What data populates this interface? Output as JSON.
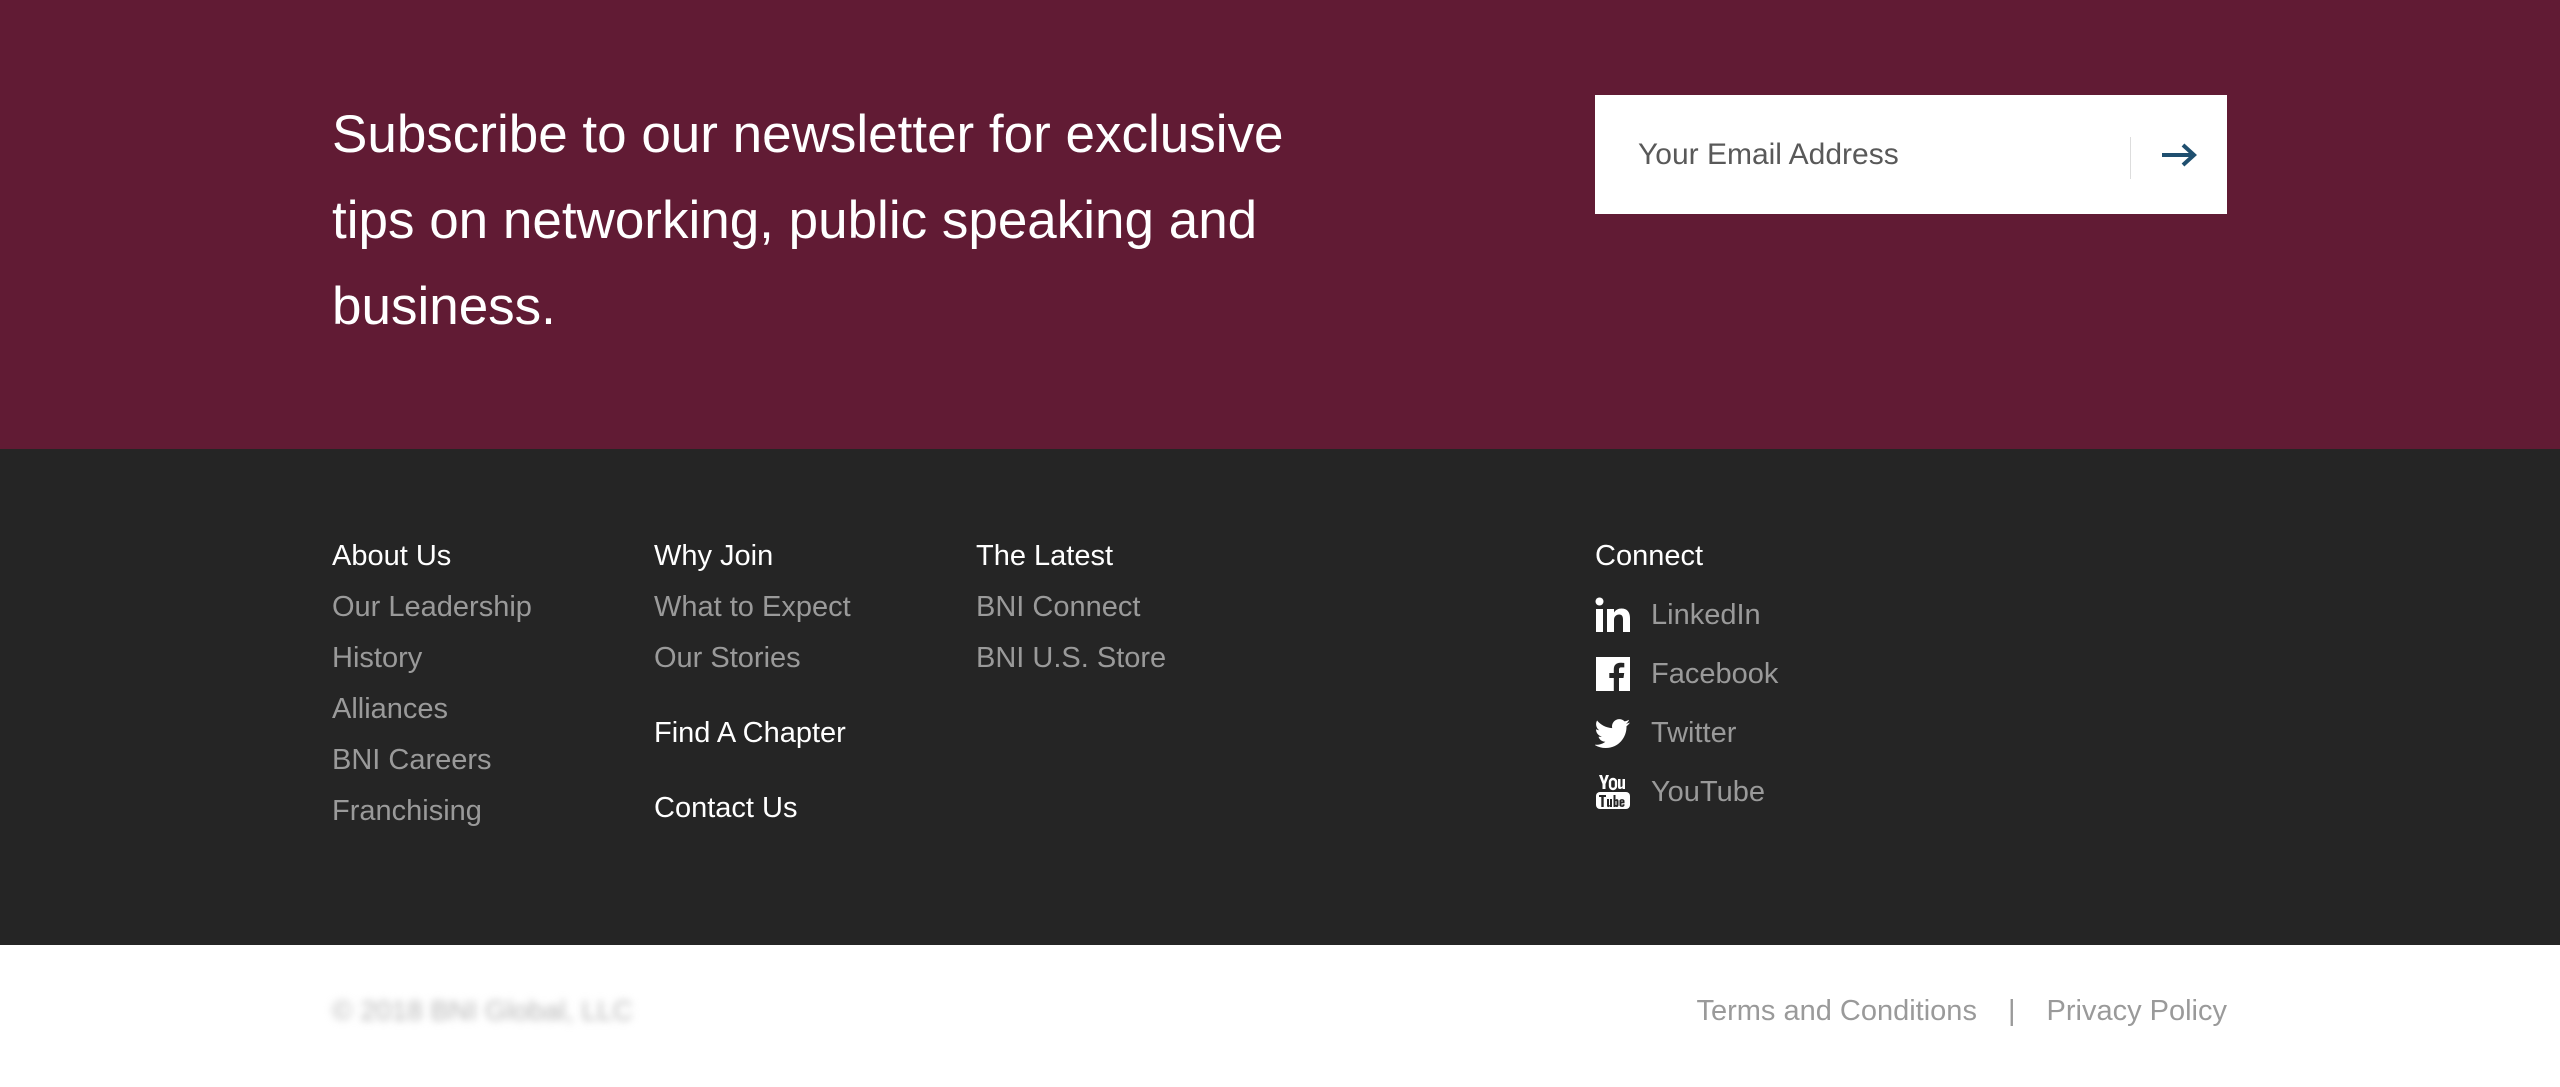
{
  "newsletter": {
    "headline": "Subscribe to our newsletter for exclusive tips on networking, public speaking and business.",
    "email_placeholder": "Your Email Address",
    "submit_icon": "arrow-right-icon",
    "accent_color": "#1f4f6f",
    "background_color": "#611b34"
  },
  "footer": {
    "background_color": "#252525",
    "columns": [
      {
        "heading": "About Us",
        "links": [
          "Our Leadership",
          "History",
          "Alliances",
          "BNI Careers",
          "Franchising"
        ]
      },
      {
        "heading": "Why Join",
        "links": [
          "What to Expect",
          "Our Stories"
        ],
        "extra_headings": [
          "Find A Chapter",
          "Contact Us"
        ]
      },
      {
        "heading": "The Latest",
        "links": [
          "BNI Connect",
          "BNI U.S. Store"
        ]
      }
    ],
    "connect": {
      "heading": "Connect",
      "items": [
        {
          "label": "LinkedIn",
          "icon": "linkedin-icon"
        },
        {
          "label": "Facebook",
          "icon": "facebook-icon"
        },
        {
          "label": "Twitter",
          "icon": "twitter-icon"
        },
        {
          "label": "YouTube",
          "icon": "youtube-icon"
        }
      ]
    }
  },
  "bottom_bar": {
    "copyright": "© 2018 BNI Global, LLC",
    "terms_label": "Terms and Conditions",
    "separator": "|",
    "privacy_label": "Privacy Policy"
  }
}
